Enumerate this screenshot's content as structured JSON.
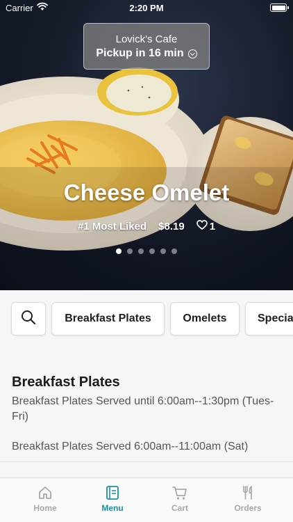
{
  "status_bar": {
    "carrier": "Carrier",
    "time": "2:20 PM"
  },
  "pickup": {
    "cafe_name": "Lovick's Cafe",
    "pickup_text": "Pickup in 16 min"
  },
  "featured": {
    "title": "Cheese Omelet",
    "rank": "#1 Most Liked",
    "price": "$8.19",
    "likes": "1",
    "carousel": {
      "total": 6,
      "active_index": 0
    }
  },
  "categories": [
    {
      "label": "Breakfast Plates"
    },
    {
      "label": "Omelets"
    },
    {
      "label": "Specia"
    }
  ],
  "section": {
    "title": "Breakfast Plates",
    "description": "Breakfast Plates Served until 6:00am--1:30pm (Tues-Fri)",
    "description_2": "Breakfast Plates Served 6:00am--11:00am (Sat)"
  },
  "tabs": [
    {
      "label": "Home",
      "icon": "home-icon",
      "active": false
    },
    {
      "label": "Menu",
      "icon": "menu-book-icon",
      "active": true
    },
    {
      "label": "Cart",
      "icon": "cart-icon",
      "active": false
    },
    {
      "label": "Orders",
      "icon": "fork-knife-icon",
      "active": false
    }
  ],
  "colors": {
    "accent": "#1e8ea5",
    "inactive": "#a8a8a8",
    "hero_bg": "#151b29"
  }
}
